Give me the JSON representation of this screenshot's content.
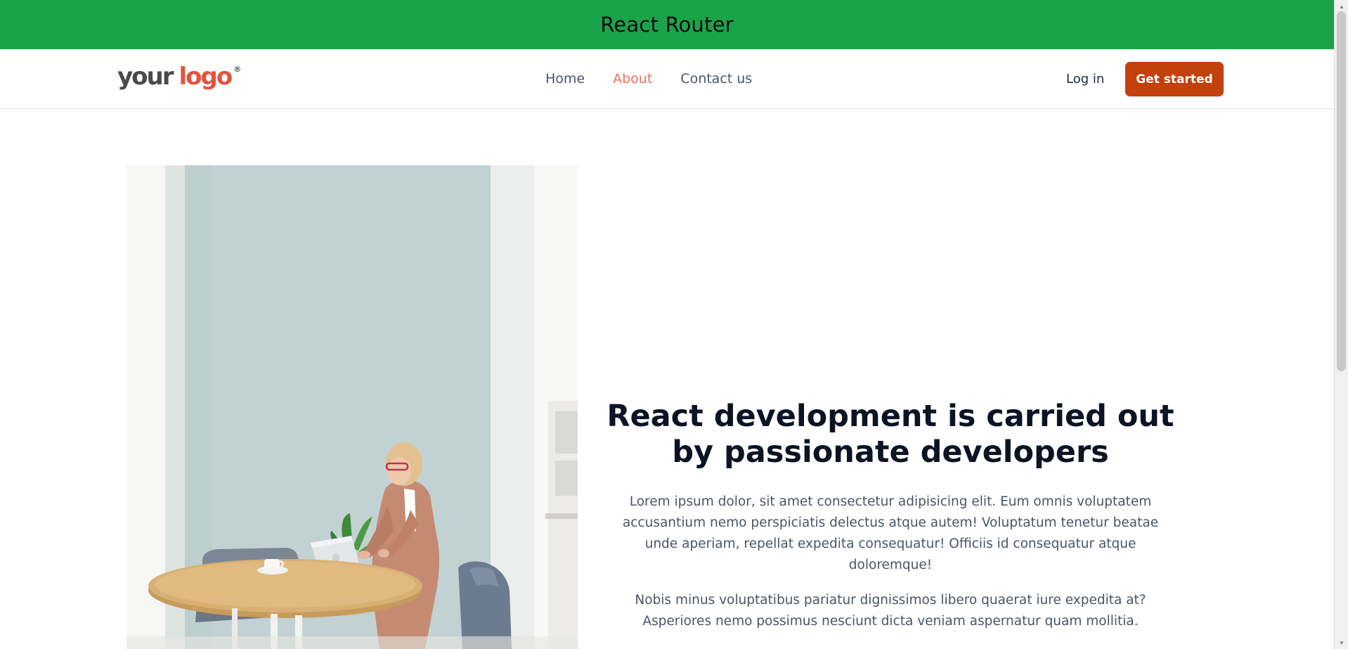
{
  "banner": {
    "title": "React Router"
  },
  "header": {
    "logo": {
      "word1": "your",
      "word2": "logo",
      "mark": "®"
    },
    "nav": [
      {
        "label": "Home",
        "active": false
      },
      {
        "label": "About",
        "active": true
      },
      {
        "label": "Contact us",
        "active": false
      }
    ],
    "login_label": "Log in",
    "cta_label": "Get started"
  },
  "hero": {
    "image_icon": "photo-office-woman-laptop",
    "heading": "React development is carried out by passionate developers",
    "paragraph1": "Lorem ipsum dolor, sit amet consectetur adipisicing elit. Eum omnis voluptatem accusantium nemo perspiciatis delectus atque autem! Voluptatum tenetur beatae unde aperiam, repellat expedita consequatur! Officiis id consequatur atque doloremque!",
    "paragraph2": "Nobis minus voluptatibus pariatur dignissimos libero quaerat iure expedita at? Asperiores nemo possimus nesciunt dicta veniam aspernatur quam mollitia."
  },
  "colors": {
    "banner": "#19a44a",
    "accent": "#e86f5f",
    "cta": "#c2410c",
    "heading": "#0b1324",
    "body_text": "#4b5563"
  }
}
